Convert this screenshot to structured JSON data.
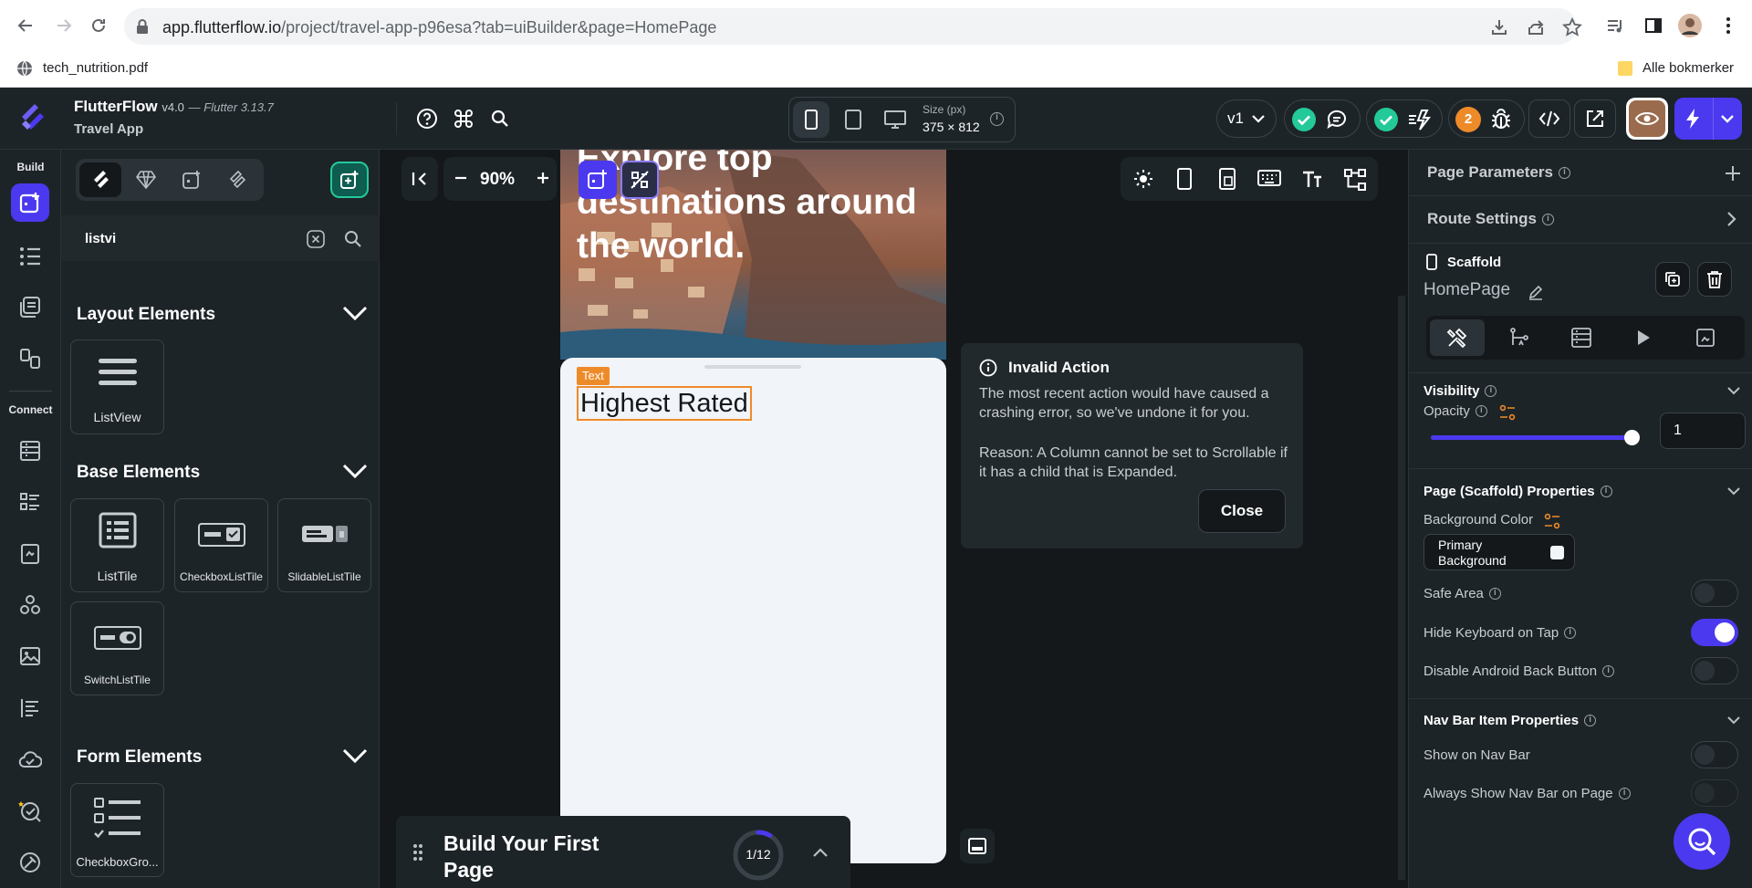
{
  "browser": {
    "url_host": "app.flutterflow.io",
    "url_path": "/project/travel-app-p96esa?tab=uiBuilder&page=HomePage",
    "bookmark": "tech_nutrition.pdf",
    "all_bookmarks": "Alle bokmerker"
  },
  "header": {
    "app_name": "FlutterFlow",
    "version": "v4.0",
    "flutter_version": "— Flutter 3.13.7",
    "project_name": "Travel App",
    "size_label": "Size (px)",
    "size_value": "375 × 812",
    "branch": "v1",
    "notif_count": "2"
  },
  "rail": {
    "build_label": "Build",
    "connect_label": "Connect"
  },
  "panel": {
    "search_value": "listvi",
    "sections": [
      {
        "title": "Layout Elements",
        "items": [
          "ListView"
        ]
      },
      {
        "title": "Base Elements",
        "items": [
          "ListTile",
          "CheckboxListTile",
          "SlidableListTile",
          "SwitchListTile"
        ]
      },
      {
        "title": "Form Elements",
        "items": [
          "CheckboxGro..."
        ]
      }
    ]
  },
  "canvas": {
    "zoom": "90%",
    "hero_line1": "Explore top",
    "hero_line2": "destinations around",
    "hero_line3": "the world.",
    "text_tag": "Text",
    "highest_rated": "Highest Rated",
    "dialog": {
      "title": "Invalid Action",
      "message": "The most recent action would have caused a crashing error, so we've undone it for you.",
      "reason": "Reason: A Column cannot be set to Scrollable if it has a child that is Expanded.",
      "close": "Close"
    },
    "onboarding": {
      "title": "Build Your First Page",
      "progress": "1/12",
      "progress_fraction": 0.0833
    }
  },
  "right": {
    "page_parameters": "Page Parameters",
    "route_settings": "Route Settings",
    "widget_type": "Scaffold",
    "widget_name": "HomePage",
    "visibility": "Visibility",
    "opacity_label": "Opacity",
    "opacity_value": "1",
    "opacity_fraction": 1.0,
    "page_props": "Page (Scaffold) Properties",
    "bg_color_label": "Background Color",
    "bg_color_value": "Primary Background",
    "safe_area": "Safe Area",
    "hide_keyboard": "Hide Keyboard on Tap",
    "disable_back": "Disable Android Back Button",
    "navbar_props": "Nav Bar Item Properties",
    "show_nav": "Show on Nav Bar",
    "always_show_nav": "Always Show Nav Bar on Page"
  },
  "colors": {
    "accent": "#4b39ef",
    "success": "#24c99a",
    "warning": "#ee8b29",
    "panel": "#1d2428",
    "canvas": "#14181b"
  }
}
